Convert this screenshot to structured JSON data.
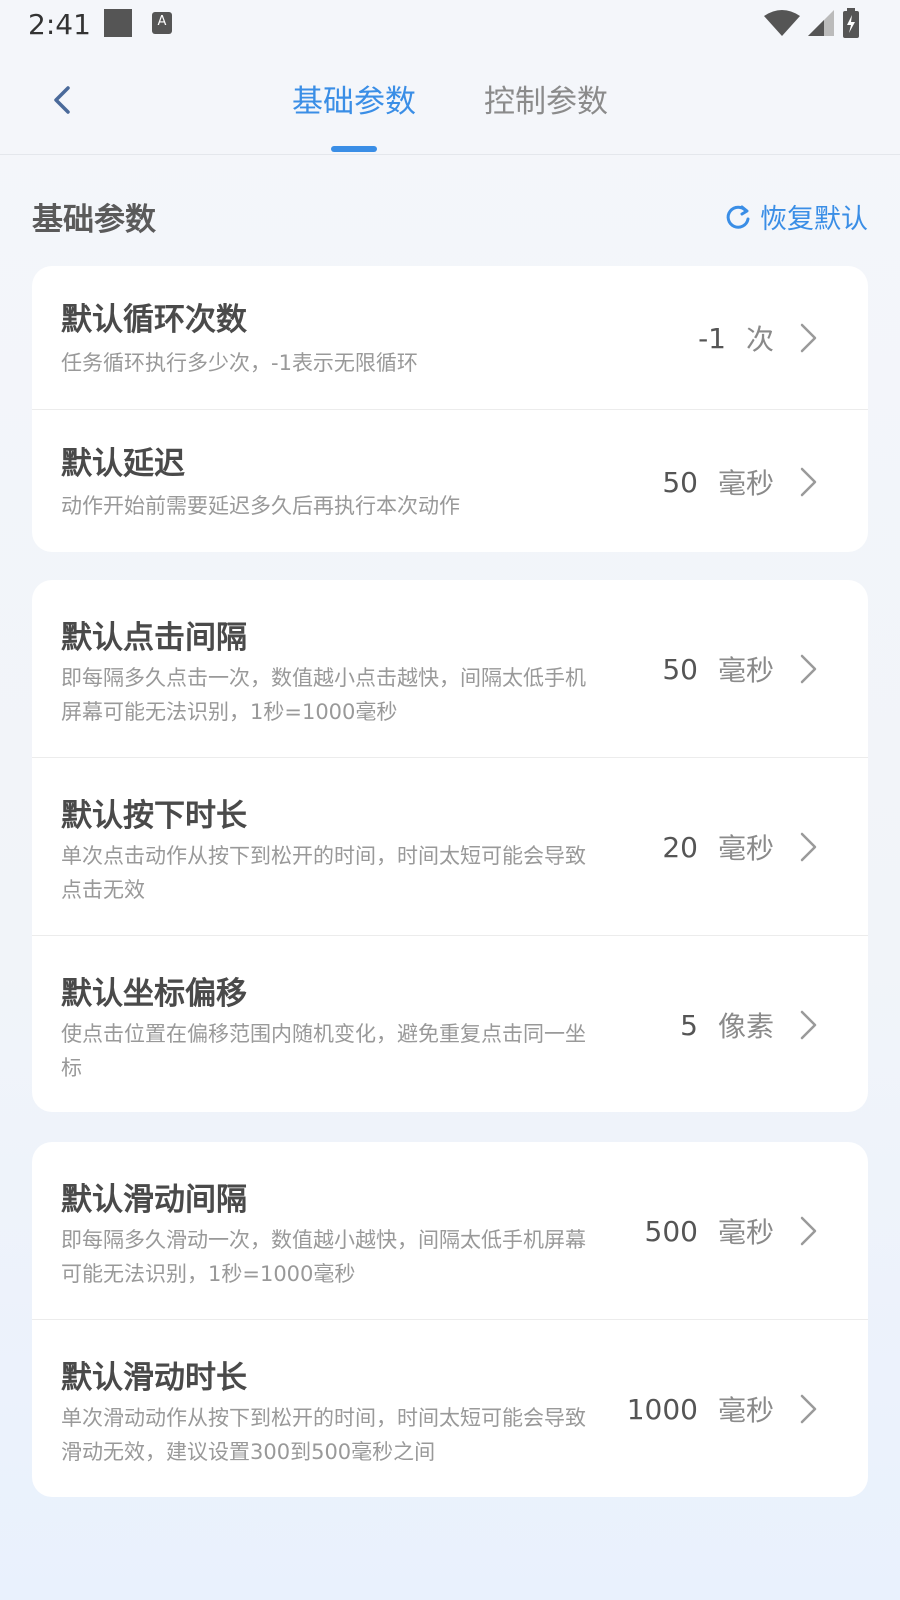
{
  "status": {
    "time": "2:41",
    "badge": "A"
  },
  "tabs": [
    {
      "label": "基础参数",
      "active": true
    },
    {
      "label": "控制参数",
      "active": false
    }
  ],
  "section": {
    "title": "基础参数",
    "restore_label": "恢复默认"
  },
  "colors": {
    "accent": "#3a8ee6",
    "background": "#f3f5f9"
  },
  "cards": [
    {
      "rows": [
        {
          "title": "默认循环次数",
          "desc": "任务循环执行多少次，-1表示无限循环",
          "value": "-1",
          "unit": "次"
        },
        {
          "title": "默认延迟",
          "desc": "动作开始前需要延迟多久后再执行本次动作",
          "value": "50",
          "unit": "毫秒"
        }
      ]
    },
    {
      "rows": [
        {
          "title": "默认点击间隔",
          "desc": "即每隔多久点击一次，数值越小点击越快，间隔太低手机屏幕可能无法识别，1秒=1000毫秒",
          "value": "50",
          "unit": "毫秒"
        },
        {
          "title": "默认按下时长",
          "desc": "单次点击动作从按下到松开的时间，时间太短可能会导致点击无效",
          "value": "20",
          "unit": "毫秒"
        },
        {
          "title": "默认坐标偏移",
          "desc": "使点击位置在偏移范围内随机变化，避免重复点击同一坐标",
          "value": "5",
          "unit": "像素"
        }
      ]
    },
    {
      "rows": [
        {
          "title": "默认滑动间隔",
          "desc": "即每隔多久滑动一次，数值越小越快，间隔太低手机屏幕可能无法识别，1秒=1000毫秒",
          "value": "500",
          "unit": "毫秒"
        },
        {
          "title": "默认滑动时长",
          "desc": "单次滑动动作从按下到松开的时间，时间太短可能会导致滑动无效，建议设置300到500毫秒之间",
          "value": "1000",
          "unit": "毫秒"
        }
      ]
    }
  ]
}
